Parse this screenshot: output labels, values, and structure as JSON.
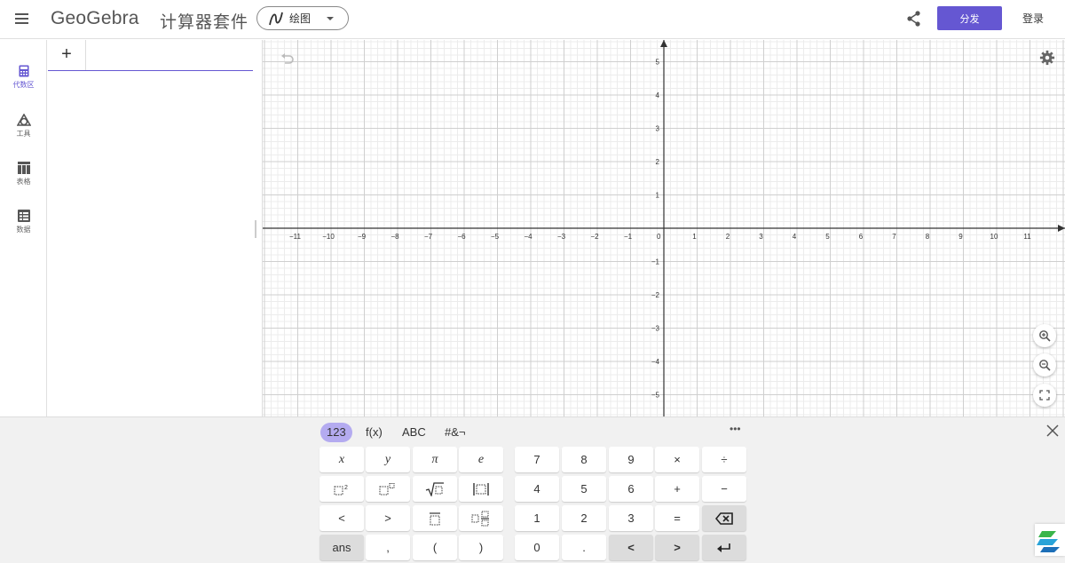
{
  "header": {
    "logo": "GeoGebra",
    "suite_title": "计算器套件",
    "app_picker_label": "绘图",
    "distribute_label": "分发",
    "login_label": "登录",
    "accent": "#6557d2"
  },
  "rail": {
    "items": [
      {
        "label": "代数区",
        "icon": "calculator-icon"
      },
      {
        "label": "工具",
        "icon": "tools-icon"
      },
      {
        "label": "表格",
        "icon": "table-icon"
      },
      {
        "label": "数据",
        "icon": "data-icon"
      }
    ]
  },
  "algebra": {
    "add_label": "+"
  },
  "graphics": {
    "x_range": [
      -11,
      11
    ],
    "y_range": [
      -5,
      5
    ],
    "x_ticks": [
      "−11",
      "−10",
      "−9",
      "−8",
      "−7",
      "−6",
      "−5",
      "−4",
      "−3",
      "−2",
      "−1",
      "0",
      "1",
      "2",
      "3",
      "4",
      "5",
      "6",
      "7",
      "8",
      "9",
      "10",
      "11"
    ],
    "y_ticks": [
      "5",
      "4",
      "3",
      "2",
      "1",
      "−1",
      "−2",
      "−3",
      "−4",
      "−5"
    ],
    "grid": true
  },
  "keyboard": {
    "tabs": [
      "123",
      "f(x)",
      "ABC",
      "#&¬"
    ],
    "more": "•••",
    "keys": {
      "x": "x",
      "y": "y",
      "pi": "π",
      "e": "e",
      "n7": "7",
      "n8": "8",
      "n9": "9",
      "times": "×",
      "divide": "÷",
      "n4": "4",
      "n5": "5",
      "n6": "6",
      "plus": "+",
      "minus": "−",
      "lt": "<",
      "gt": ">",
      "n1": "1",
      "n2": "2",
      "n3": "3",
      "equals": "=",
      "ans": "ans",
      "comma": ",",
      "lparen": "(",
      "rparen": ")",
      "n0": "0",
      "dot": ".",
      "left": "<",
      "right": ">"
    }
  }
}
